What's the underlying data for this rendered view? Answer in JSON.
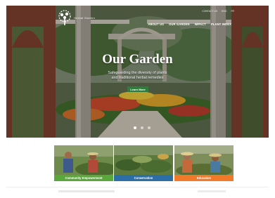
{
  "brand": {
    "name": "Herbal Garden",
    "logo_icon": "tree-logo-icon"
  },
  "topbar": {
    "contact_label": "CONTACT US",
    "lang_1": "ENG",
    "lang_2": "FR"
  },
  "nav": {
    "items": [
      {
        "label": "ABOUT US"
      },
      {
        "label": "OUR GARDEN"
      },
      {
        "label": "IMPACT"
      },
      {
        "label": "PLANT INDEX"
      }
    ]
  },
  "hero": {
    "title": "Our Garden",
    "subtitle_line1": "Safeguarding the diversity of plants",
    "subtitle_line2": "and traditional herbal remedies",
    "button_label": "Learn More",
    "slides_total": 3,
    "slide_active": 1
  },
  "cards": [
    {
      "label": "Community Empowerment",
      "color": "#5aa83a"
    },
    {
      "label": "Conservation",
      "color": "#2c6ea6"
    },
    {
      "label": "Education",
      "color": "#f07a2a"
    }
  ],
  "colors": {
    "button": "#2f7d3b",
    "brick": "#8a4a36"
  }
}
